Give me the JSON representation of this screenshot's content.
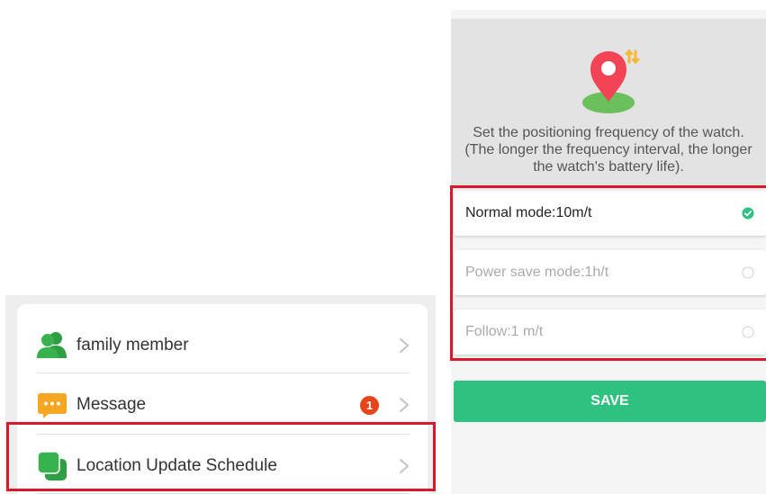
{
  "menu": {
    "items": [
      {
        "label": "family member",
        "icon": "family-member-icon"
      },
      {
        "label": "Message",
        "icon": "message-icon",
        "badge": "1"
      },
      {
        "label": "Location Update Schedule",
        "icon": "location-schedule-icon"
      }
    ]
  },
  "location_settings": {
    "header_icon": "location-pin-update-icon",
    "description": "Set the positioning frequency of the watch. (The longer the frequency interval, the longer the watch's battery life).",
    "modes": [
      {
        "label": "Normal mode:10m/t",
        "selected": true
      },
      {
        "label": "Power save mode:1h/t",
        "selected": false
      },
      {
        "label": "Follow:1 m/t",
        "selected": false
      }
    ],
    "save_label": "SAVE"
  },
  "colors": {
    "accent_green": "#2ec17f",
    "icon_green": "#37b24d",
    "message_orange": "#f5a623",
    "badge_red": "#e8441b",
    "highlight_red": "#d7192b",
    "pin_red": "#f24455"
  }
}
